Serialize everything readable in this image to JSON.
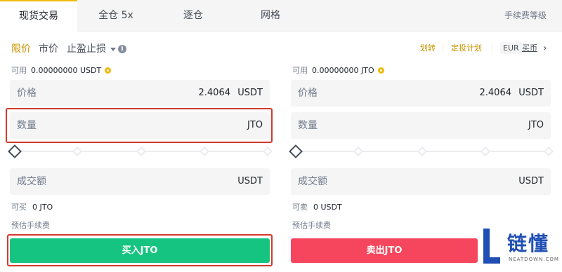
{
  "tabs": [
    {
      "label": "现货交易"
    },
    {
      "label": "全仓 5x"
    },
    {
      "label": "逐仓"
    },
    {
      "label": "网格"
    }
  ],
  "fee_level": "手续费等级",
  "order_types": [
    "限价",
    "市价",
    "止盈止损"
  ],
  "toolbar": {
    "transfer": "划转",
    "auto_invest": "定投计划",
    "currency": "EUR",
    "buy_coin": "买币"
  },
  "buy": {
    "available_label": "可用",
    "available_value": "0.00000000 USDT",
    "price": {
      "label": "价格",
      "value": "2.4064",
      "unit": "USDT"
    },
    "amount": {
      "label": "数量",
      "unit": "JTO"
    },
    "total": {
      "label": "成交额",
      "unit": "USDT"
    },
    "max_label": "可买",
    "max_value": "0 JTO",
    "fee_label": "预估手续费",
    "button": "买入JTO",
    "slider_percent": 0
  },
  "sell": {
    "available_label": "可用",
    "available_value": "0.00000000 JTO",
    "price": {
      "label": "价格",
      "value": "2.4064",
      "unit": "USDT"
    },
    "amount": {
      "label": "数量",
      "unit": "JTO"
    },
    "total": {
      "label": "成交额",
      "unit": "USDT"
    },
    "max_label": "可卖",
    "max_value": "0 USDT",
    "fee_label": "预估手续费",
    "button": "卖出JTO",
    "slider_percent": 0
  },
  "watermark": {
    "name": "链懂",
    "sub": "NEATDOWN.COM"
  },
  "colors": {
    "accent": "#f0b90b",
    "buy": "#15c480",
    "sell": "#f6465d",
    "highlight": "#d33a2c"
  }
}
